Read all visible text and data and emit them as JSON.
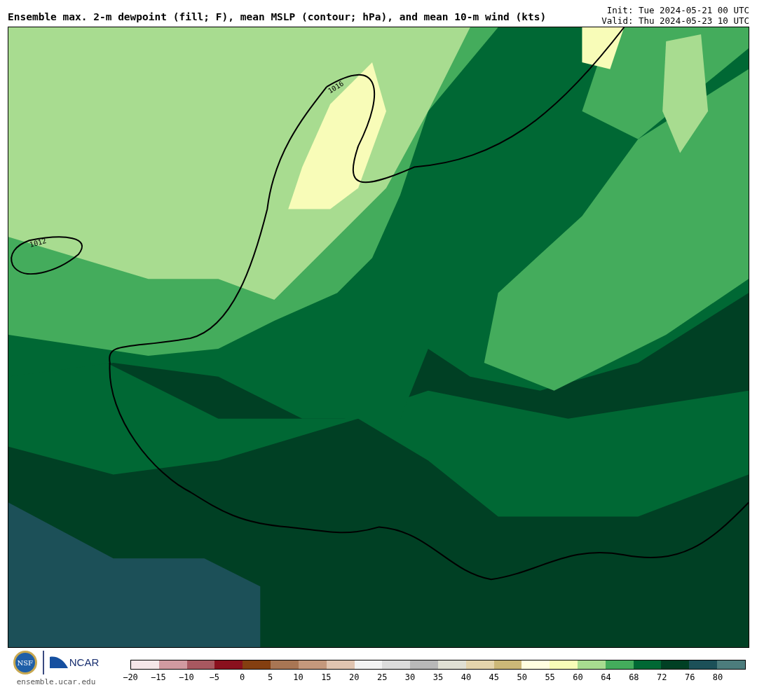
{
  "header": {
    "title": "Ensemble max. 2-m dewpoint (fill; F), mean MSLP (contour; hPa), and mean 10-m wind (kts)",
    "init": "Init: Tue 2024-05-21 00 UTC",
    "valid": "Valid: Thu 2024-05-23 10 UTC"
  },
  "map": {
    "contour_labels": [
      "1016",
      "1012"
    ]
  },
  "footer": {
    "nsf_logo": "NSF",
    "ncar_logo": "NCAR",
    "url": "ensemble.ucar.edu"
  },
  "colorbar": {
    "segments": [
      {
        "color": "#f5e6e8"
      },
      {
        "color": "#d09aa0"
      },
      {
        "color": "#a85860"
      },
      {
        "color": "#8a101e"
      },
      {
        "color": "#843f10"
      },
      {
        "color": "#a87654"
      },
      {
        "color": "#c4987c"
      },
      {
        "color": "#e0c4b0"
      },
      {
        "color": "#f2f2f2"
      },
      {
        "color": "#dcdcdc"
      },
      {
        "color": "#b8b8b8"
      },
      {
        "color": "#e0e0d4"
      },
      {
        "color": "#e4d4ac"
      },
      {
        "color": "#ccb878"
      },
      {
        "color": "#fffee0"
      },
      {
        "color": "#f8fcb8"
      },
      {
        "color": "#a8dc90"
      },
      {
        "color": "#44ac5c"
      },
      {
        "color": "#006834"
      },
      {
        "color": "#004024"
      },
      {
        "color": "#1c5058"
      },
      {
        "color": "#4c7c7c"
      }
    ],
    "ticks": [
      "−20",
      "−15",
      "−10",
      "−5",
      "0",
      "5",
      "10",
      "15",
      "20",
      "25",
      "30",
      "35",
      "40",
      "45",
      "50",
      "55",
      "60",
      "64",
      "68",
      "72",
      "76",
      "80"
    ]
  }
}
